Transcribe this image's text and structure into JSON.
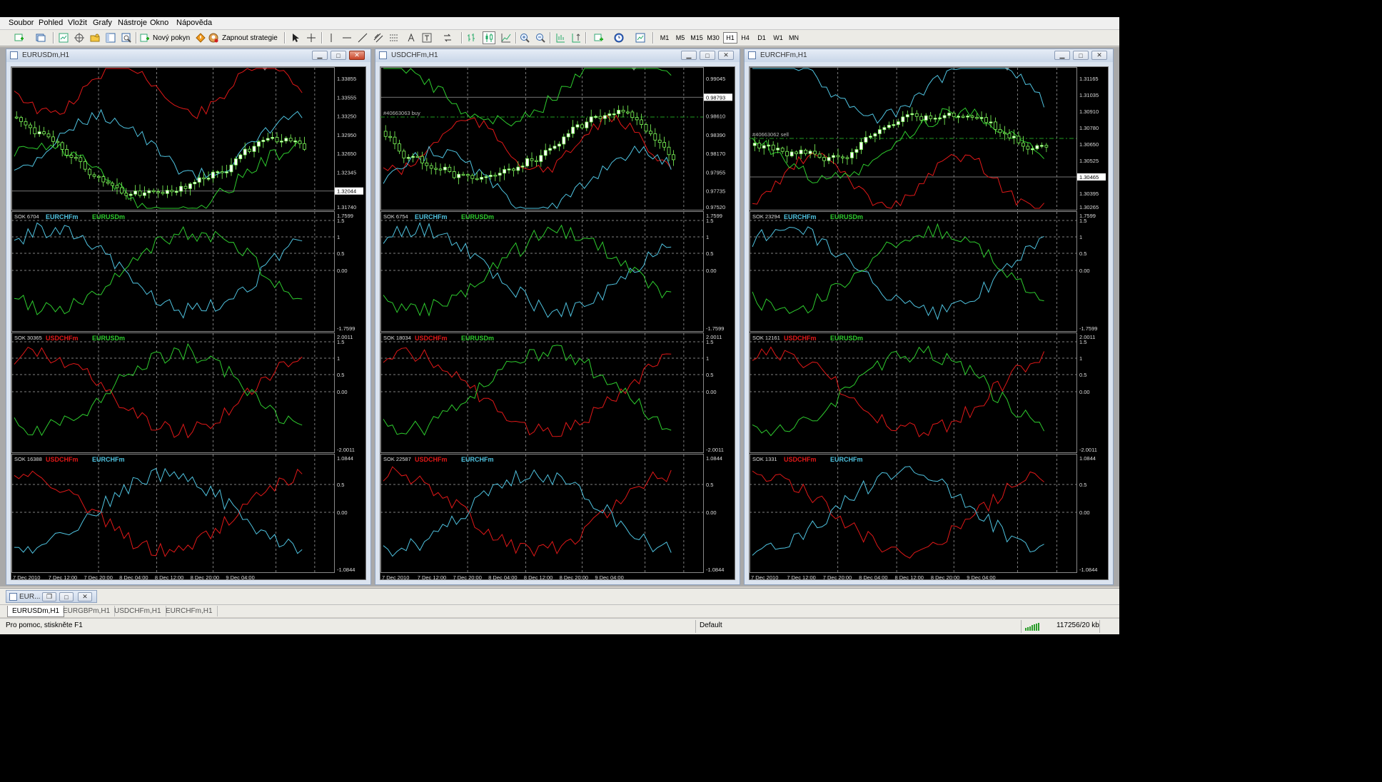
{
  "menu": [
    "Soubor",
    "Pohled",
    "Vložit",
    "Grafy",
    "Nástroje",
    "Okno",
    "Nápověda"
  ],
  "toolbar": {
    "new_order_label": "Nový pokyn",
    "strategy_label": "Zapnout strategie",
    "timeframes": [
      "M1",
      "M5",
      "M15",
      "M30",
      "H1",
      "H4",
      "D1",
      "W1",
      "MN"
    ],
    "active_timeframe": "H1"
  },
  "windows": [
    {
      "title": "EURUSDm,H1",
      "price_axis": [
        "1.33855",
        "1.33555",
        "1.33250",
        "1.32950",
        "1.32650",
        "1.32345",
        "1.32044",
        "1.31740"
      ],
      "current_price": "1.32044",
      "order_label": "",
      "pane1": {
        "sok": "SOK 6704",
        "a": "EURCHFm",
        "b": "EURUSDm",
        "axis": [
          "1.7599",
          "1.5",
          "1",
          "0.5",
          "0.00",
          "-1.7599"
        ]
      },
      "pane2": {
        "sok": "SOK 30365",
        "a": "USDCHFm",
        "b": "EURUSDm",
        "axis": [
          "2.0011",
          "1.5",
          "1",
          "0.5",
          "0.00",
          "-2.0011"
        ]
      },
      "pane3": {
        "sok": "SOK 16388",
        "a": "USDCHFm",
        "b": "EURCHFm",
        "axis": [
          "1.0844",
          "0.5",
          "0.00",
          "-1.0844"
        ]
      },
      "dates": [
        "7 Dec 2010",
        "7 Dec 12:00",
        "7 Dec 20:00",
        "8 Dec 04:00",
        "8 Dec 12:00",
        "8 Dec 20:00",
        "9 Dec 04:00"
      ]
    },
    {
      "title": "USDCHFm,H1",
      "price_axis": [
        "0.99045",
        "0.98793",
        "0.98610",
        "0.98390",
        "0.98170",
        "0.97955",
        "0.97735",
        "0.97520"
      ],
      "current_price": "0.98793",
      "order_label": "#40663063 buy",
      "pane1": {
        "sok": "SOK 6754",
        "a": "EURCHFm",
        "b": "EURUSDm",
        "axis": [
          "1.7599",
          "1.5",
          "1",
          "0.5",
          "0.00",
          "-1.7599"
        ]
      },
      "pane2": {
        "sok": "SOK 18034",
        "a": "USDCHFm",
        "b": "EURUSDm",
        "axis": [
          "2.0011",
          "1.5",
          "1",
          "0.5",
          "0.00",
          "-2.0011"
        ]
      },
      "pane3": {
        "sok": "SOK 22587",
        "a": "USDCHFm",
        "b": "EURCHFm",
        "axis": [
          "1.0844",
          "0.5",
          "0.00",
          "-1.0844"
        ]
      },
      "dates": [
        "7 Dec 2010",
        "7 Dec 12:00",
        "7 Dec 20:00",
        "8 Dec 04:00",
        "8 Dec 12:00",
        "8 Dec 20:00",
        "9 Dec 04:00"
      ]
    },
    {
      "title": "EURCHFm,H1",
      "price_axis": [
        "1.31165",
        "1.31035",
        "1.30910",
        "1.30780",
        "1.30650",
        "1.30525",
        "1.30465",
        "1.30395",
        "1.30265"
      ],
      "current_price": "1.30465",
      "order_label": "#40663062 sell",
      "pane1": {
        "sok": "SOK 23294",
        "a": "EURCHFm",
        "b": "EURUSDm",
        "axis": [
          "1.7599",
          "1.5",
          "1",
          "0.5",
          "0.00",
          "-1.7599"
        ]
      },
      "pane2": {
        "sok": "SOK 12161",
        "a": "USDCHFm",
        "b": "EURUSDm",
        "axis": [
          "2.0011",
          "1.5",
          "1",
          "0.5",
          "0.00",
          "-2.0011"
        ]
      },
      "pane3": {
        "sok": "SOK 1331",
        "a": "USDCHFm",
        "b": "EURCHFm",
        "axis": [
          "1.0844",
          "0.5",
          "0.00",
          "-1.0844"
        ]
      },
      "dates": [
        "7 Dec 2010",
        "7 Dec 12:00",
        "7 Dec 20:00",
        "8 Dec 04:00",
        "8 Dec 12:00",
        "8 Dec 20:00",
        "9 Dec 04:00"
      ]
    }
  ],
  "minimized_window": "EUR...",
  "tabs": [
    "EURUSDm,H1",
    "EURGBPm,H1",
    "USDCHFm,H1",
    "EURCHFm,H1"
  ],
  "active_tab": "EURUSDm,H1",
  "status": {
    "help": "Pro pomoc, stiskněte F1",
    "profile": "Default",
    "traffic": "117256/20 kb"
  },
  "colors": {
    "cyan": "#4fc3e0",
    "green": "#2ecc2e",
    "red": "#e01818",
    "bull": "#ffffff",
    "bear": "#9cff6a"
  }
}
